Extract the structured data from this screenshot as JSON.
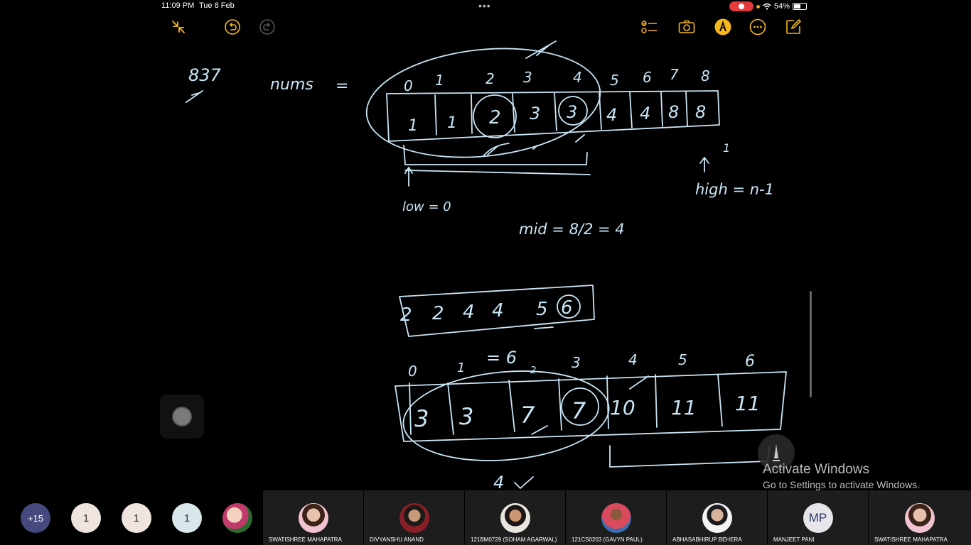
{
  "status": {
    "time": "11:09 PM",
    "date": "Tue 8 Feb",
    "battery": "54%"
  },
  "colors": {
    "accent": "#f5b81c",
    "ink": "#c9e6f7",
    "record": "#e23b3b"
  },
  "toolbar": {
    "left_icons": [
      "collapse-icon",
      "undo-icon",
      "redo-icon"
    ],
    "right_icons": [
      "checklist-icon",
      "camera-icon",
      "markup-pen-icon",
      "more-icon",
      "compose-icon"
    ]
  },
  "notes": {
    "corner_number": "837",
    "nums_label": "nums",
    "equals": "=",
    "top_indices": [
      "0",
      "1",
      "2",
      "3",
      "4",
      "5",
      "6",
      "7",
      "8"
    ],
    "top_values": [
      "1",
      "1",
      "2",
      "3",
      "3",
      "4",
      "4",
      "8",
      "8"
    ],
    "low_label": "low = 0",
    "high_label": "high = n-1",
    "high_mark": "1",
    "mid_label": "mid = 8/2 = 4",
    "mid_values": [
      "2",
      "2",
      "4",
      "4",
      "5",
      "6"
    ],
    "eq6": "= 6",
    "eq6_sub": "2",
    "bottom_indices": [
      "0",
      "1",
      "3",
      "4",
      "5",
      "6"
    ],
    "bottom_values": [
      "3",
      "3",
      "7",
      "7",
      "10",
      "11",
      "11"
    ],
    "bottom_count": "4"
  },
  "watermark": {
    "title": "Activate Windows",
    "subtitle": "Go to Settings to activate Windows."
  },
  "participants": {
    "overflow_count": "+15",
    "counters": [
      "1",
      "1",
      "1"
    ],
    "tiles": [
      {
        "name": "SWATISHREE MAHAPATRA",
        "avatar": "photo"
      },
      {
        "name": "DIVYANSHU ANAND",
        "avatar": "photo"
      },
      {
        "name": "121BM0729 (SOHAM AGARWAL)",
        "avatar": "photo"
      },
      {
        "name": "121CS0203 (GAVYN PAUL)",
        "avatar": "photo"
      },
      {
        "name": "ABHASABHIRUP BEHERA",
        "avatar": "photo"
      },
      {
        "name": "MANJEET PANI",
        "avatar": "MP"
      },
      {
        "name": "SWATISHREE MAHAPATRA",
        "avatar": "photo"
      }
    ]
  }
}
